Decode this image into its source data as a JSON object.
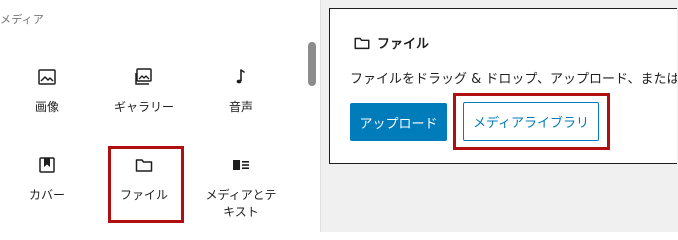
{
  "inserter": {
    "category": "メディア",
    "blocks": [
      {
        "label": "画像",
        "icon": "image-icon"
      },
      {
        "label": "ギャラリー",
        "icon": "gallery-icon"
      },
      {
        "label": "音声",
        "icon": "audio-icon"
      },
      {
        "label": "カバー",
        "icon": "cover-icon"
      },
      {
        "label": "ファイル",
        "icon": "file-icon"
      },
      {
        "label": "メディアとテキスト",
        "icon": "media-text-icon"
      }
    ],
    "highlighted_block": "ファイル"
  },
  "file_block": {
    "title": "ファイル",
    "instructions": "ファイルをドラッグ & ドロップ、アップロード、またはラ",
    "upload_label": "アップロード",
    "library_label": "メディアライブラリ",
    "highlighted_button": "メディアライブラリ"
  },
  "colors": {
    "accent": "#007cba",
    "highlight": "#b10f0f",
    "editor_bg": "#f0f0f0"
  }
}
